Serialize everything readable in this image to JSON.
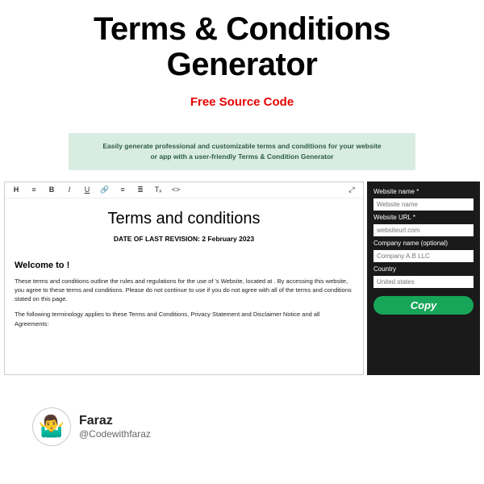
{
  "hero": {
    "title_line1": "Terms & Conditions",
    "title_line2": "Generator",
    "subtitle": "Free Source Code"
  },
  "banner": {
    "text": "Easily generate professional and customizable terms and conditions for your website or app with a user-friendly Terms & Condition Generator"
  },
  "toolbar": {
    "heading": "H",
    "align": "≡",
    "bold": "B",
    "italic": "I",
    "underline": "U",
    "link": "🔗",
    "list_ul": "≡",
    "list_ol": "≣",
    "tx": "Tₓ",
    "code": "<>",
    "expand": "⤢"
  },
  "editor": {
    "title": "Terms and conditions",
    "date": "DATE OF LAST REVISION: 2 February 2023",
    "welcome": "Welcome to !",
    "p1": "These terms and conditions outline the rules and regulations for the use of 's Website, located at . By accessing this website, you agree to these terms and conditions. Please do not continue to use if you do not agree with all of the terms and conditions stated on this page.",
    "p2": "The following terminology applies to these Terms and Conditions, Privacy Statement and Disclaimer Notice and all Agreements:"
  },
  "sidebar": {
    "website_name_label": "Website name *",
    "website_name_ph": "Website name",
    "website_url_label": "Website URL *",
    "website_url_ph": "websiteurl.com",
    "company_label": "Company name (optional)",
    "company_ph": "Company A.B LLC",
    "country_label": "Country",
    "country_ph": "United states",
    "copy": "Copy"
  },
  "footer": {
    "avatar_emoji": "🤷‍♂️",
    "name": "Faraz",
    "handle": "@Codewithfaraz"
  }
}
